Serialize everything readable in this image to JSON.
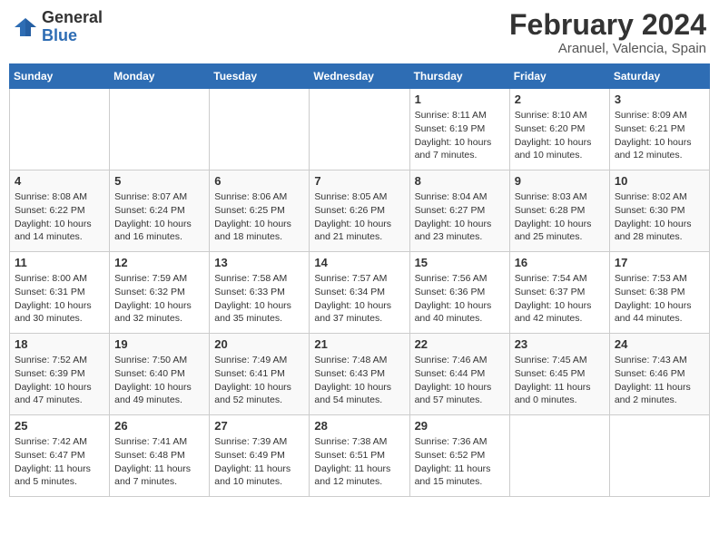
{
  "header": {
    "logo_line1": "General",
    "logo_line2": "Blue",
    "title": "February 2024",
    "subtitle": "Aranuel, Valencia, Spain"
  },
  "weekdays": [
    "Sunday",
    "Monday",
    "Tuesday",
    "Wednesday",
    "Thursday",
    "Friday",
    "Saturday"
  ],
  "weeks": [
    [
      {
        "day": "",
        "info": ""
      },
      {
        "day": "",
        "info": ""
      },
      {
        "day": "",
        "info": ""
      },
      {
        "day": "",
        "info": ""
      },
      {
        "day": "1",
        "info": "Sunrise: 8:11 AM\nSunset: 6:19 PM\nDaylight: 10 hours\nand 7 minutes."
      },
      {
        "day": "2",
        "info": "Sunrise: 8:10 AM\nSunset: 6:20 PM\nDaylight: 10 hours\nand 10 minutes."
      },
      {
        "day": "3",
        "info": "Sunrise: 8:09 AM\nSunset: 6:21 PM\nDaylight: 10 hours\nand 12 minutes."
      }
    ],
    [
      {
        "day": "4",
        "info": "Sunrise: 8:08 AM\nSunset: 6:22 PM\nDaylight: 10 hours\nand 14 minutes."
      },
      {
        "day": "5",
        "info": "Sunrise: 8:07 AM\nSunset: 6:24 PM\nDaylight: 10 hours\nand 16 minutes."
      },
      {
        "day": "6",
        "info": "Sunrise: 8:06 AM\nSunset: 6:25 PM\nDaylight: 10 hours\nand 18 minutes."
      },
      {
        "day": "7",
        "info": "Sunrise: 8:05 AM\nSunset: 6:26 PM\nDaylight: 10 hours\nand 21 minutes."
      },
      {
        "day": "8",
        "info": "Sunrise: 8:04 AM\nSunset: 6:27 PM\nDaylight: 10 hours\nand 23 minutes."
      },
      {
        "day": "9",
        "info": "Sunrise: 8:03 AM\nSunset: 6:28 PM\nDaylight: 10 hours\nand 25 minutes."
      },
      {
        "day": "10",
        "info": "Sunrise: 8:02 AM\nSunset: 6:30 PM\nDaylight: 10 hours\nand 28 minutes."
      }
    ],
    [
      {
        "day": "11",
        "info": "Sunrise: 8:00 AM\nSunset: 6:31 PM\nDaylight: 10 hours\nand 30 minutes."
      },
      {
        "day": "12",
        "info": "Sunrise: 7:59 AM\nSunset: 6:32 PM\nDaylight: 10 hours\nand 32 minutes."
      },
      {
        "day": "13",
        "info": "Sunrise: 7:58 AM\nSunset: 6:33 PM\nDaylight: 10 hours\nand 35 minutes."
      },
      {
        "day": "14",
        "info": "Sunrise: 7:57 AM\nSunset: 6:34 PM\nDaylight: 10 hours\nand 37 minutes."
      },
      {
        "day": "15",
        "info": "Sunrise: 7:56 AM\nSunset: 6:36 PM\nDaylight: 10 hours\nand 40 minutes."
      },
      {
        "day": "16",
        "info": "Sunrise: 7:54 AM\nSunset: 6:37 PM\nDaylight: 10 hours\nand 42 minutes."
      },
      {
        "day": "17",
        "info": "Sunrise: 7:53 AM\nSunset: 6:38 PM\nDaylight: 10 hours\nand 44 minutes."
      }
    ],
    [
      {
        "day": "18",
        "info": "Sunrise: 7:52 AM\nSunset: 6:39 PM\nDaylight: 10 hours\nand 47 minutes."
      },
      {
        "day": "19",
        "info": "Sunrise: 7:50 AM\nSunset: 6:40 PM\nDaylight: 10 hours\nand 49 minutes."
      },
      {
        "day": "20",
        "info": "Sunrise: 7:49 AM\nSunset: 6:41 PM\nDaylight: 10 hours\nand 52 minutes."
      },
      {
        "day": "21",
        "info": "Sunrise: 7:48 AM\nSunset: 6:43 PM\nDaylight: 10 hours\nand 54 minutes."
      },
      {
        "day": "22",
        "info": "Sunrise: 7:46 AM\nSunset: 6:44 PM\nDaylight: 10 hours\nand 57 minutes."
      },
      {
        "day": "23",
        "info": "Sunrise: 7:45 AM\nSunset: 6:45 PM\nDaylight: 11 hours\nand 0 minutes."
      },
      {
        "day": "24",
        "info": "Sunrise: 7:43 AM\nSunset: 6:46 PM\nDaylight: 11 hours\nand 2 minutes."
      }
    ],
    [
      {
        "day": "25",
        "info": "Sunrise: 7:42 AM\nSunset: 6:47 PM\nDaylight: 11 hours\nand 5 minutes."
      },
      {
        "day": "26",
        "info": "Sunrise: 7:41 AM\nSunset: 6:48 PM\nDaylight: 11 hours\nand 7 minutes."
      },
      {
        "day": "27",
        "info": "Sunrise: 7:39 AM\nSunset: 6:49 PM\nDaylight: 11 hours\nand 10 minutes."
      },
      {
        "day": "28",
        "info": "Sunrise: 7:38 AM\nSunset: 6:51 PM\nDaylight: 11 hours\nand 12 minutes."
      },
      {
        "day": "29",
        "info": "Sunrise: 7:36 AM\nSunset: 6:52 PM\nDaylight: 11 hours\nand 15 minutes."
      },
      {
        "day": "",
        "info": ""
      },
      {
        "day": "",
        "info": ""
      }
    ]
  ]
}
